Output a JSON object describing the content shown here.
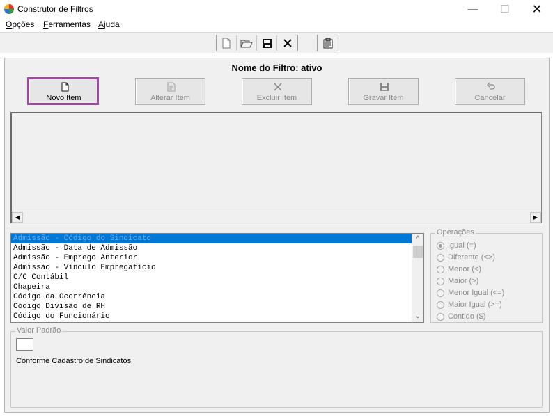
{
  "window": {
    "title": "Construtor de Filtros"
  },
  "menu": {
    "items": [
      {
        "u": "O",
        "rest": "pções"
      },
      {
        "u": "F",
        "rest": "erramentas"
      },
      {
        "u": "A",
        "rest": "juda"
      }
    ]
  },
  "toolbar": {
    "icons": [
      "new-document-icon",
      "open-folder-icon",
      "save-icon",
      "delete-x-icon",
      "properties-icon"
    ]
  },
  "filter": {
    "name_label": "Nome do Filtro: ativo"
  },
  "actions": {
    "new_item": "Novo Item",
    "edit_item": "Alterar Item",
    "delete_item": "Excluir Item",
    "save_item": "Gravar Item",
    "cancel": "Cancelar"
  },
  "fields": {
    "selected_index": 0,
    "items": [
      "Admissão - Código do Sindicato",
      "Admissão - Data de Admissão",
      "Admissão - Emprego Anterior",
      "Admissão - Vínculo Empregatício",
      "C/C Contábil",
      "Chapeira",
      "Código da Ocorrência",
      "Código Divisão de RH",
      "Código do Funcionário"
    ]
  },
  "operations": {
    "legend": "Operações",
    "options": [
      "Igual (=)",
      "Diferente (<>)",
      "Menor (<)",
      "Maior  (>)",
      "Menor Igual (<=)",
      "Maior Igual (>=)",
      "Contido ($)"
    ],
    "selected_index": 0
  },
  "default_value": {
    "legend": "Valor Padrão",
    "value": "",
    "description": "Conforme Cadastro de Sindicatos"
  },
  "colors": {
    "accent_highlight": "#9b4a9e",
    "selection": "#0078d7"
  }
}
